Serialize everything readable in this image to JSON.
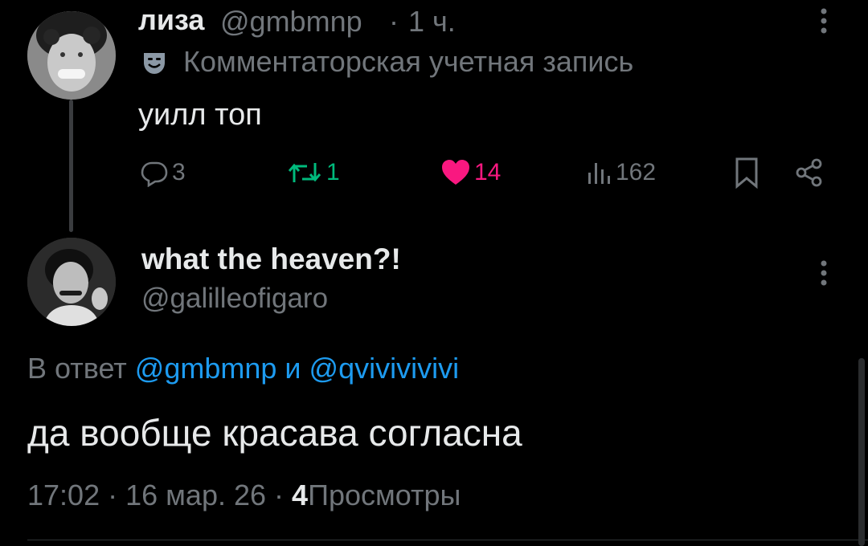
{
  "parent_tweet": {
    "author_name": "лиза",
    "author_handle": "@gmbmnp",
    "separator": "·",
    "time_ago": "1 ч.",
    "community_label": "Комментаторская учетная запись",
    "text": "уилл топ",
    "replies": "3",
    "retweets": "1",
    "likes": "14",
    "views": "162",
    "icons": {
      "reply": "reply-icon",
      "retweet": "retweet-icon",
      "like": "heart-icon",
      "views": "views-chart-icon",
      "bookmark": "bookmark-icon",
      "share": "share-icon",
      "community": "theater-mask-icon",
      "more": "more-vertical-icon"
    },
    "colors": {
      "retweet": "#00ba7c",
      "like": "#f91880"
    }
  },
  "main_tweet": {
    "author_name": "what the heaven?!",
    "author_handle": "@galilleofigaro",
    "reply_prefix": "В ответ",
    "mention_1": "@gmbmnp",
    "conjunction": "и",
    "mention_2": "@qvivivivivi",
    "text": "да вообще красава согласна",
    "time": "17:02",
    "dot_1": "·",
    "date": "16 мар. 26",
    "dot_2": "·",
    "views_count": "4",
    "views_label": "Просмотры"
  },
  "theme": {
    "background": "#000000",
    "primary_text": "#e7e9ea",
    "secondary_text": "#71767b",
    "accent": "#1d9bf0"
  }
}
